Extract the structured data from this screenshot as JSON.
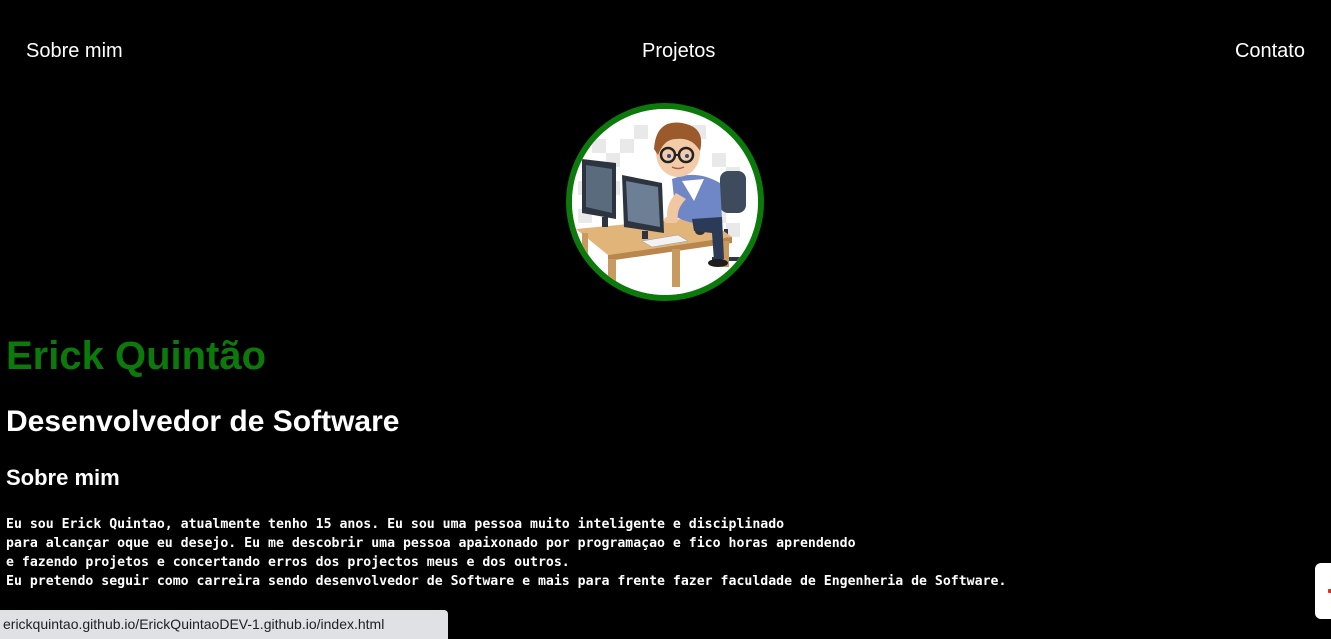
{
  "nav": {
    "items": [
      {
        "label": "Sobre mim"
      },
      {
        "label": "Projetos"
      },
      {
        "label": "Contato"
      }
    ]
  },
  "profile": {
    "avatar_icon": "developer-at-computer-illustration",
    "name": "Erick Quintão",
    "role": "Desenvolvedor de Software"
  },
  "about": {
    "heading": "Sobre mim",
    "text": "Eu sou Erick Quintao, atualmente tenho 15 anos. Eu sou uma pessoa muito inteligente e disciplinado\npara alcançar oque eu desejo. Eu me descobrir uma pessoa apaixonado por programaçao e fico horas aprendendo\ne fazendo projetos e concertando erros dos projectos meus e dos outros.\nEu pretendo seguir como carreira sendo desenvolvedor de Software e mais para frente fazer faculdade de Engenheria de Software."
  },
  "status_bar": {
    "url": "erickquintao.github.io/ErickQuintaoDEV-1.github.io/index.html"
  },
  "colors": {
    "background": "#000000",
    "accent_green": "#0b7a0b",
    "text": "#ffffff"
  }
}
